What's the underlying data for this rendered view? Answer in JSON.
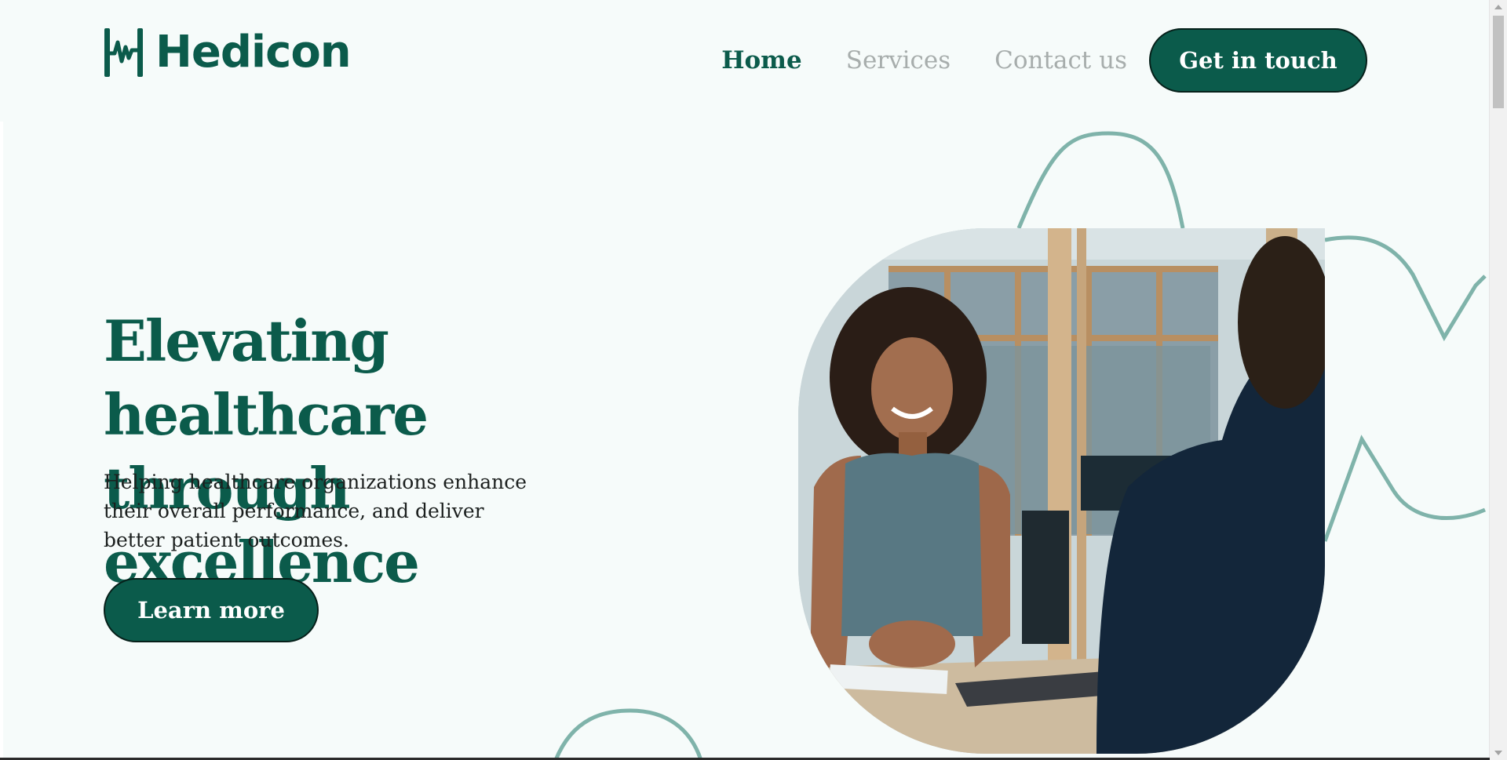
{
  "brand": {
    "name": "Hedicon",
    "logo_icon": "heartbeat-h-logo-icon",
    "color": "#0b5b4b"
  },
  "nav": {
    "links": [
      {
        "label": "Home",
        "active": true
      },
      {
        "label": "Services",
        "active": false
      },
      {
        "label": "Contact us",
        "active": false
      }
    ],
    "cta_label": "Get in touch"
  },
  "hero": {
    "title": "Elevating healthcare through excellence",
    "subtitle": "Helping healthcare organizations enhance their overall performance, and deliver better patient outcomes.",
    "button_label": "Learn more"
  },
  "colors": {
    "primary": "#0b5b4b",
    "wave": "#7fb3aa",
    "nav_inactive": "#a7adac",
    "background": "#f6fbfa"
  }
}
